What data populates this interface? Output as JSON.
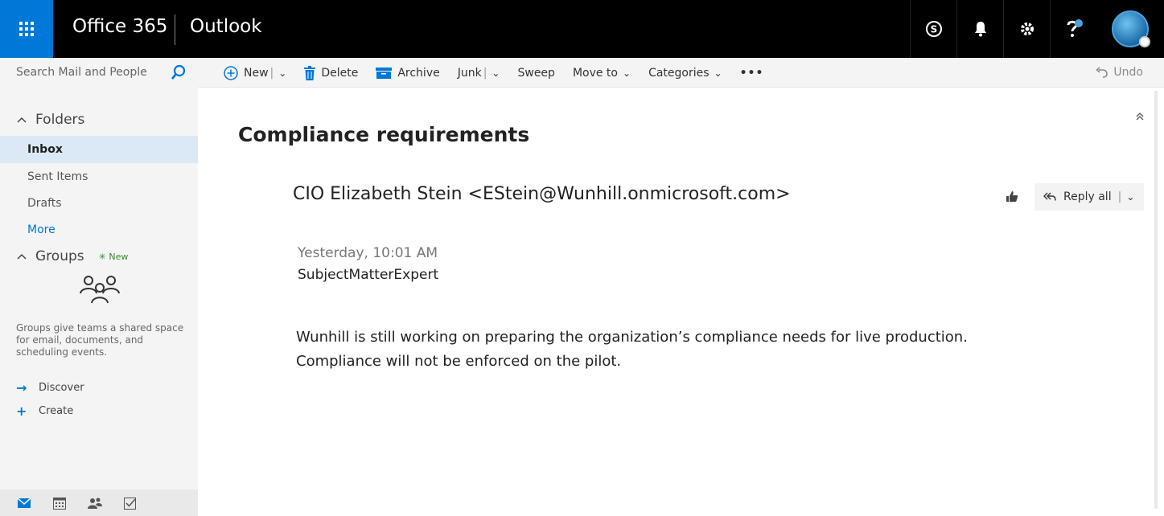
{
  "topbar": {
    "brand": "Office 365",
    "app": "Outlook",
    "icons": [
      "skype-icon",
      "bell-icon",
      "gear-icon",
      "help-icon",
      "avatar"
    ]
  },
  "search": {
    "placeholder": "Search Mail and People"
  },
  "commands": {
    "new": "New",
    "delete": "Delete",
    "archive": "Archive",
    "junk": "Junk",
    "sweep": "Sweep",
    "move_to": "Move to",
    "categories": "Categories",
    "more": "•••",
    "undo": "Undo"
  },
  "nav": {
    "folders_header": "Folders",
    "folders": [
      {
        "label": "Inbox",
        "selected": true
      },
      {
        "label": "Sent Items",
        "selected": false
      },
      {
        "label": "Drafts",
        "selected": false
      }
    ],
    "more": "More",
    "groups_header": "Groups",
    "groups_new": "New",
    "groups_desc": "Groups give teams a shared space for email, documents, and scheduling events.",
    "discover": "Discover",
    "create": "Create"
  },
  "message": {
    "subject": "Compliance requirements",
    "sender": "CIO Elizabeth Stein <EStein@Wunhill.onmicrosoft.com>",
    "reply_label": "Reply all",
    "date": "Yesterday, 10:01 AM",
    "to": "SubjectMatterExpert",
    "body": "Wunhill is still working on preparing the organization’s compliance needs for live production. Compliance will not be enforced on the pilot."
  },
  "colors": {
    "accent": "#0078d7",
    "topbar": "#000000",
    "selected": "#dbe8f6"
  }
}
